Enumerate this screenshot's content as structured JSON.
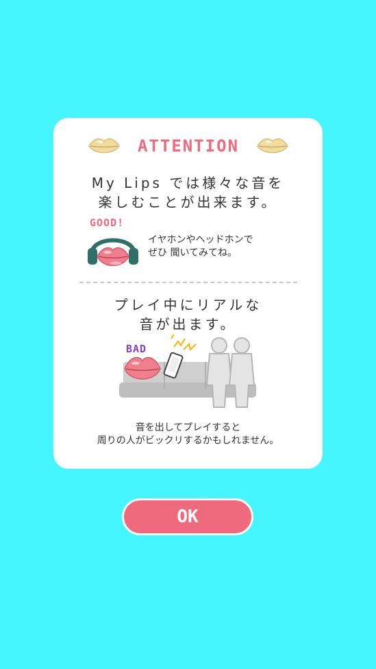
{
  "dialog": {
    "title": "ATTENTION",
    "intro_text": "My Lips では様々な音を\n楽しむことが出来ます。",
    "good": {
      "label": "GOOD!",
      "text": "イヤホンやヘッドホンで\nぜひ 聞いてみてね。",
      "icon": "lips-with-headphones-icon"
    },
    "warning_text": "プレイ中にリアルな\n音が出ます。",
    "bad": {
      "label": "BAD",
      "text": "音を出してプレイすると\n周りの人がビックリするかもしれません。",
      "icon": "lips-on-train-icon"
    }
  },
  "ok_button": {
    "label": "OK"
  },
  "colors": {
    "background": "#45f5ff",
    "accent_pink": "#ee6a7c",
    "bad_purple": "#8b3fcf",
    "card": "#ffffff",
    "gold_lips": "#f2dc9e"
  }
}
